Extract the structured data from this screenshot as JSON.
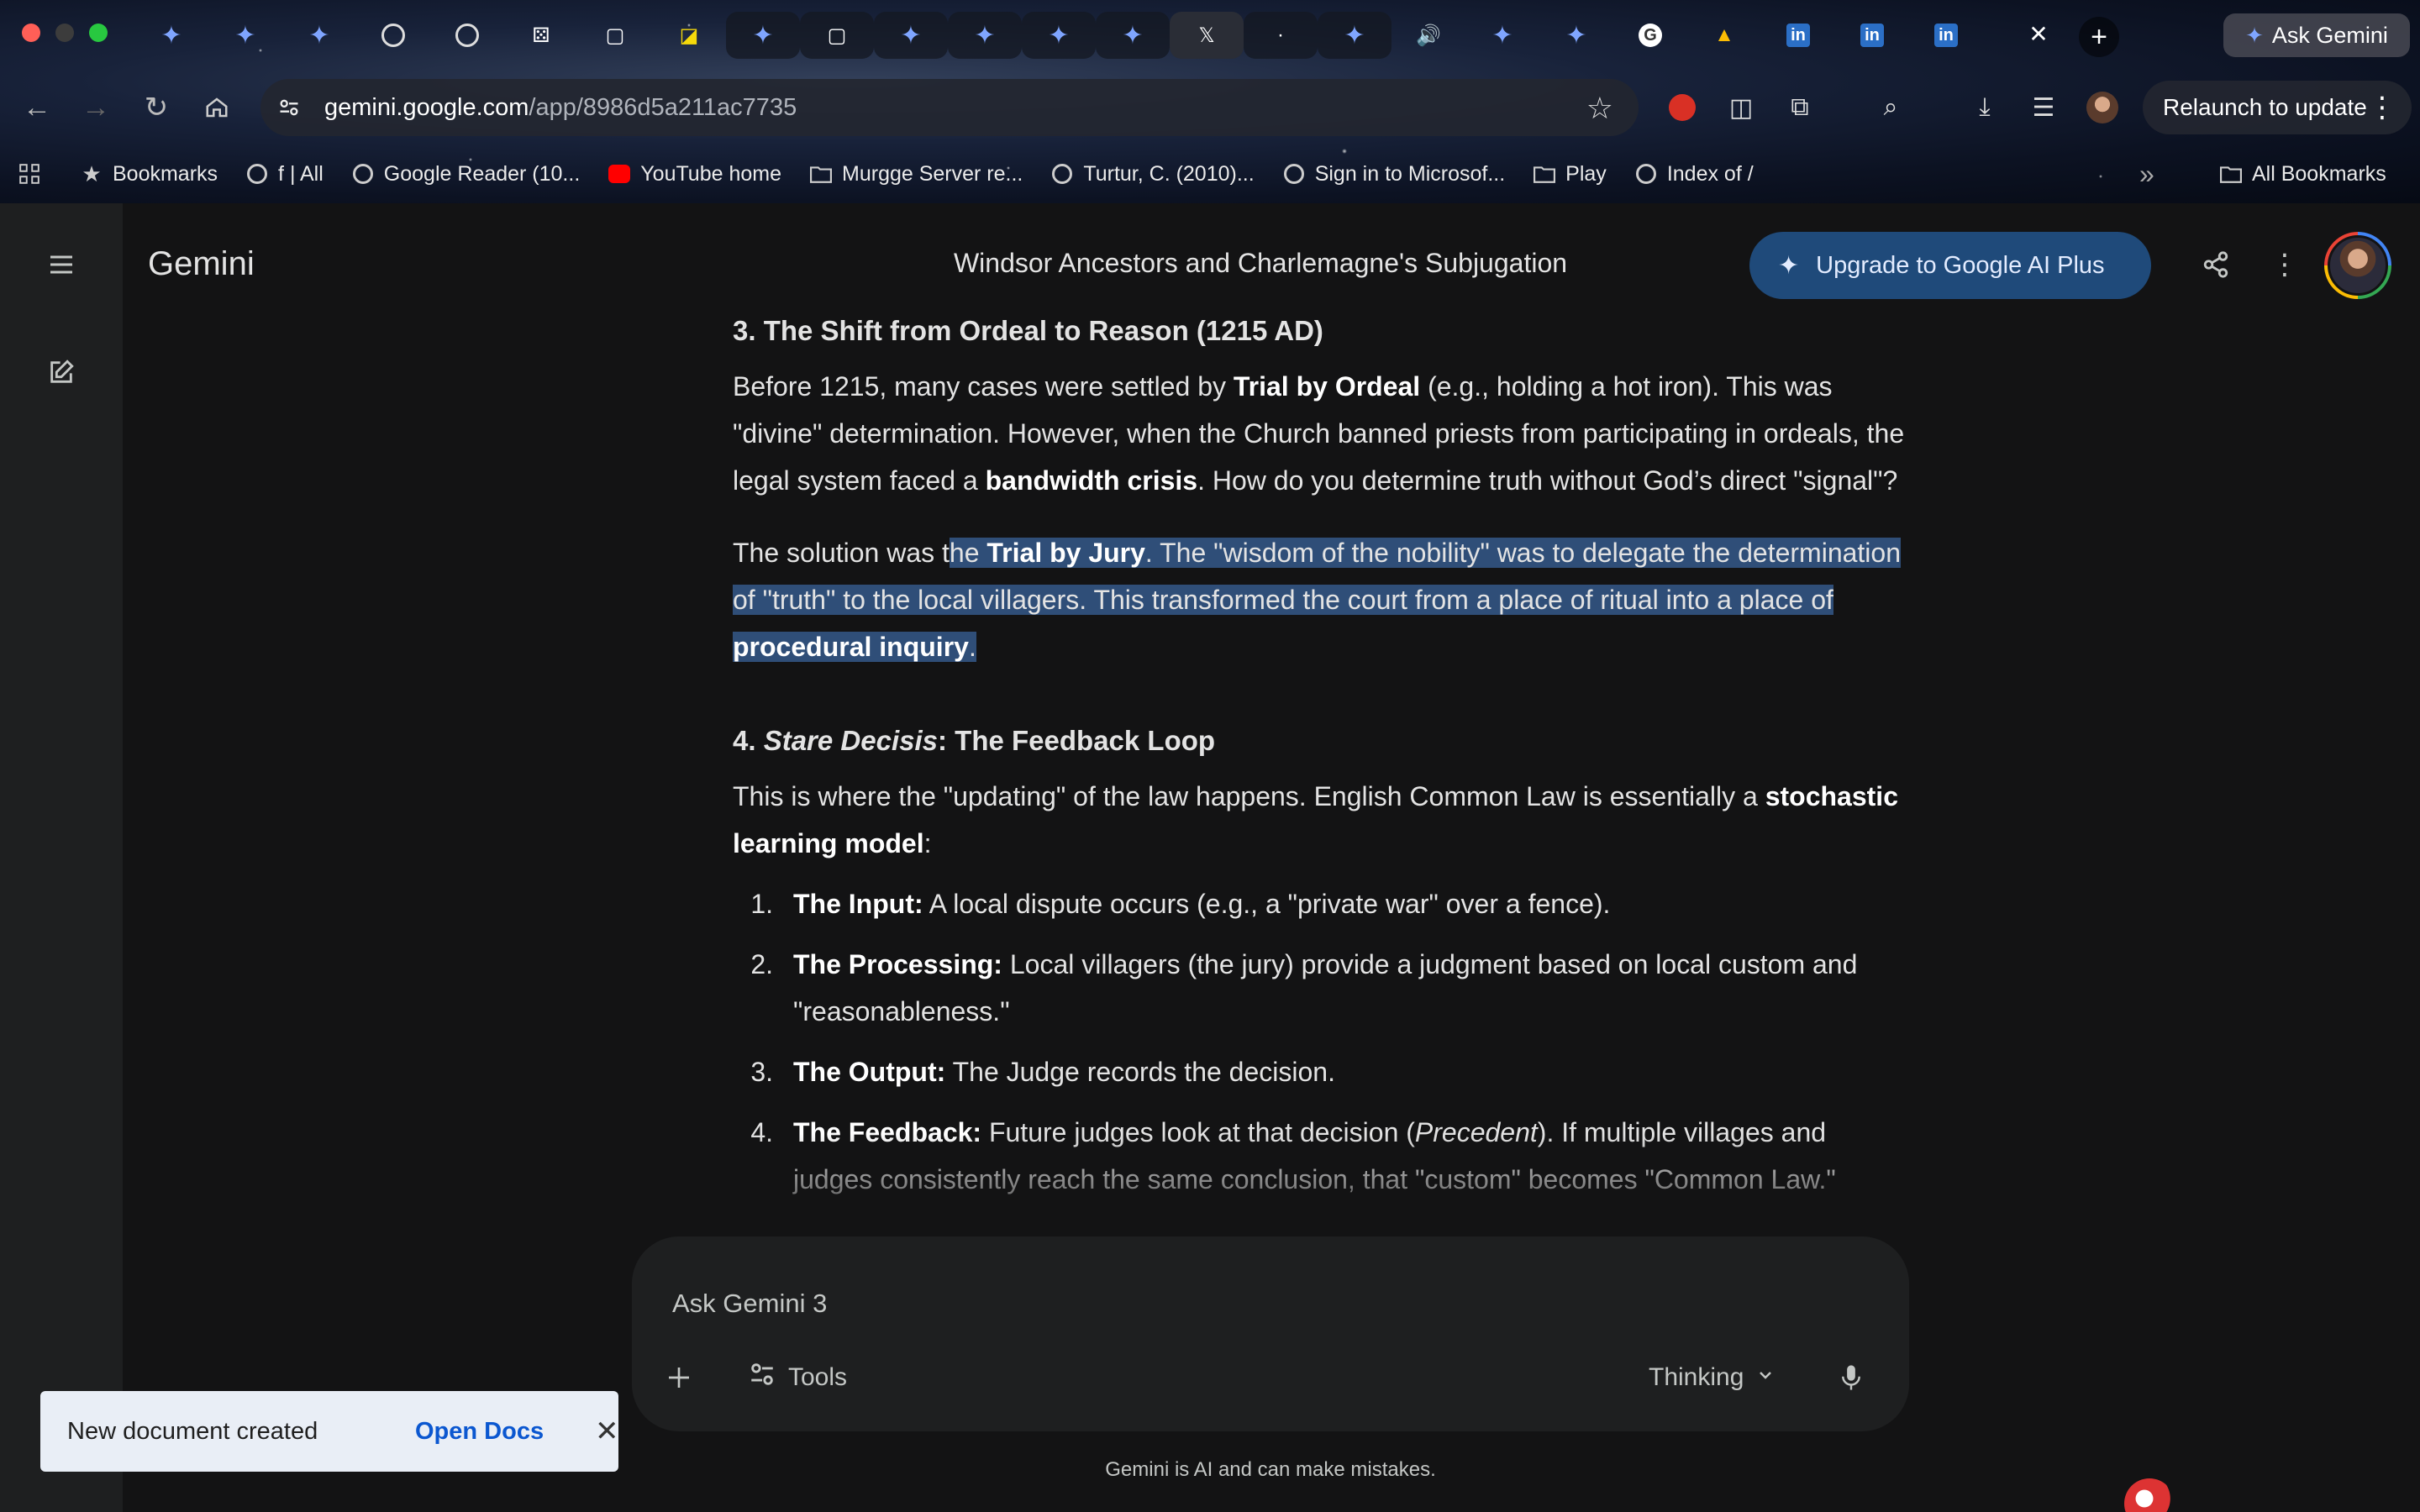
{
  "browser": {
    "tabs": [
      {
        "icon": "gemini-spark-icon"
      },
      {
        "icon": "gemini-spark-icon"
      },
      {
        "icon": "gemini-spark-icon"
      },
      {
        "icon": "globe-icon"
      },
      {
        "icon": "globe-icon"
      },
      {
        "icon": "dice-icon"
      },
      {
        "icon": "app-icon"
      },
      {
        "icon": "yellow-app-icon"
      },
      {
        "icon": "gemini-spark-icon"
      },
      {
        "icon": "app-icon"
      },
      {
        "icon": "gemini-spark-icon"
      },
      {
        "icon": "gemini-spark-icon"
      },
      {
        "icon": "gemini-spark-icon"
      },
      {
        "icon": "gemini-spark-icon"
      },
      {
        "icon": "x-icon"
      },
      {
        "icon": "dot-icon"
      },
      {
        "icon": "gemini-spark-icon"
      },
      {
        "icon": "speaker-icon"
      },
      {
        "icon": "gemini-spark-icon"
      },
      {
        "icon": "gemini-spark-icon"
      },
      {
        "icon": "google-g-icon"
      },
      {
        "icon": "google-drive-icon"
      },
      {
        "icon": "linkedin-icon",
        "label": "in"
      },
      {
        "icon": "linkedin-icon",
        "label": "in"
      },
      {
        "icon": "linkedin-icon",
        "label": "in"
      }
    ],
    "close_tab": "✕",
    "new_tab": "+",
    "ask_gemini": "Ask Gemini",
    "url_host": "gemini.google.com",
    "url_path": "/app/8986d5a211ac7735",
    "relaunch": "Relaunch to update",
    "bookmarks": [
      {
        "label": "Bookmarks",
        "icon": "star-icon"
      },
      {
        "label": "f | All",
        "icon": "globe-icon"
      },
      {
        "label": "Google Reader (10...",
        "icon": "globe-icon"
      },
      {
        "label": "YouTube home",
        "icon": "youtube-icon"
      },
      {
        "label": "Murgge Server re...",
        "icon": "folder-icon"
      },
      {
        "label": "Turtur, C. (2010)...",
        "icon": "globe-icon"
      },
      {
        "label": "Sign in to Microsof...",
        "icon": "globe-icon"
      },
      {
        "label": "Play",
        "icon": "folder-icon"
      },
      {
        "label": "Index of /",
        "icon": "globe-icon"
      }
    ],
    "overflow": "»",
    "all_bookmarks": "All Bookmarks"
  },
  "app": {
    "brand": "Gemini",
    "conversation_title": "Windsor Ancestors and Charlemagne's Subjugation",
    "upgrade_label": "Upgrade to Google AI Plus",
    "colors": {
      "upgrade_bg": "#1f4a7a",
      "highlight": "#2f4e78",
      "background": "#131314"
    }
  },
  "content": {
    "section3_heading": "3. The Shift from Ordeal to Reason (1215 AD)",
    "p1": [
      "Before 1215, many cases were settled by ",
      "Trial by Ordeal",
      " (e.g., holding a hot iron). This was \"divine\" determination. However, when the Church banned priests from participating in ordeals, the legal system faced a ",
      "bandwidth crisis",
      ". How do you determine truth without God’s direct \"signal\"?"
    ],
    "p2": [
      "The solution was t",
      "he ",
      "Trial by Jury",
      ". The \"wisdom of the nobility\" was to delegate the determination of \"truth\" to the local villagers. This transformed the court from a place of ritual into a place of ",
      "procedural inquiry",
      "."
    ],
    "section4_heading": [
      "4. ",
      "Stare Decisis",
      ": The Feedback Loop"
    ],
    "p3": [
      "This is where the \"updating\" of the law happens. English Common Law is essentially a ",
      "stochastic learning model",
      ":"
    ],
    "list": [
      {
        "num": "1.",
        "bold": "The Input:",
        "text": " A local dispute occurs (e.g., a \"private war\" over a fence)."
      },
      {
        "num": "2.",
        "bold": "The Processing:",
        "text": " Local villagers (the jury) provide a judgment based on local custom and \"reasonableness.\""
      },
      {
        "num": "3.",
        "bold": "The Output:",
        "text": " The Judge records the decision."
      },
      {
        "num": "4.",
        "bold": "The Feedback:",
        "text_a": " Future judges look at that decision (",
        "italic": "Precedent",
        "text_b": "). If multiple villages and judges consistently reach the same conclusion, that \"custom\" becomes \"Common Law.\""
      }
    ]
  },
  "composer": {
    "placeholder": "Ask Gemini 3",
    "tools": "Tools",
    "mode": "Thinking"
  },
  "disclaimer": "Gemini is AI and can make mistakes.",
  "toast": {
    "message": "New document created",
    "action": "Open Docs"
  }
}
